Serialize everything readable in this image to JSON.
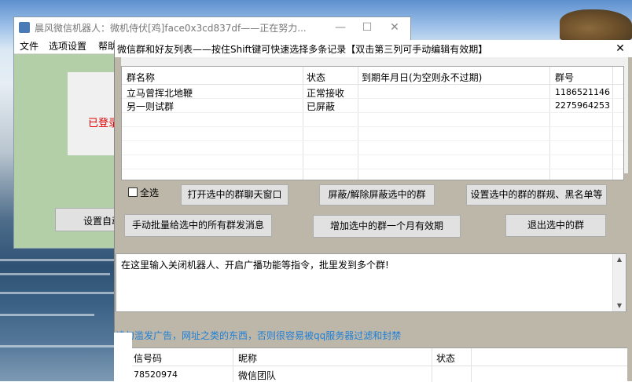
{
  "back_window": {
    "title": "晨风微信机器人：微机侍伏[鸡]face0x3cd837df——正在努力...",
    "minimize_glyph": "—",
    "maximize_glyph": "☐",
    "close_glyph": "✕",
    "menu": [
      "文件",
      "选项设置",
      "帮助"
    ],
    "status_text": "已登录",
    "settings_button_label": "设置自动"
  },
  "dialog": {
    "title": "微信群和好友列表——按住Shift键可快速选择多条记录【双击第三列可手动编辑有效期】",
    "close_glyph": "✕",
    "group_table": {
      "headers": [
        "群名称",
        "状态",
        "到期年月日(为空则永不过期)",
        "群号"
      ],
      "rows": [
        [
          "立马曾挥北地鞭",
          "正常接收",
          "",
          "1186521146"
        ],
        [
          "另一则试群",
          "已屏蔽",
          "",
          "2275964253"
        ]
      ]
    },
    "select_all_label": "全选",
    "buttons": {
      "open_chat": "打开选中的群聊天窗口",
      "toggle_block": "屏蔽/解除屏蔽选中的群",
      "set_rules": "设置选中的群的群规、黑名单等",
      "batch_message": "手动批量给选中的所有群发消息",
      "add_month": "增加选中的群一个月有效期",
      "quit_group": "退出选中的群"
    },
    "message_text": "在这里输入关闭机器人、开启广播功能等指令，批里发到多个群!",
    "warning_text": "请勿滥发广告，网址之类的东西，否则很容易被qq服务器过滤和封禁",
    "friend_table": {
      "headers": [
        "信号码",
        "昵称",
        "状态"
      ],
      "rows": [
        [
          "78520974",
          "微信团队",
          ""
        ]
      ]
    }
  }
}
